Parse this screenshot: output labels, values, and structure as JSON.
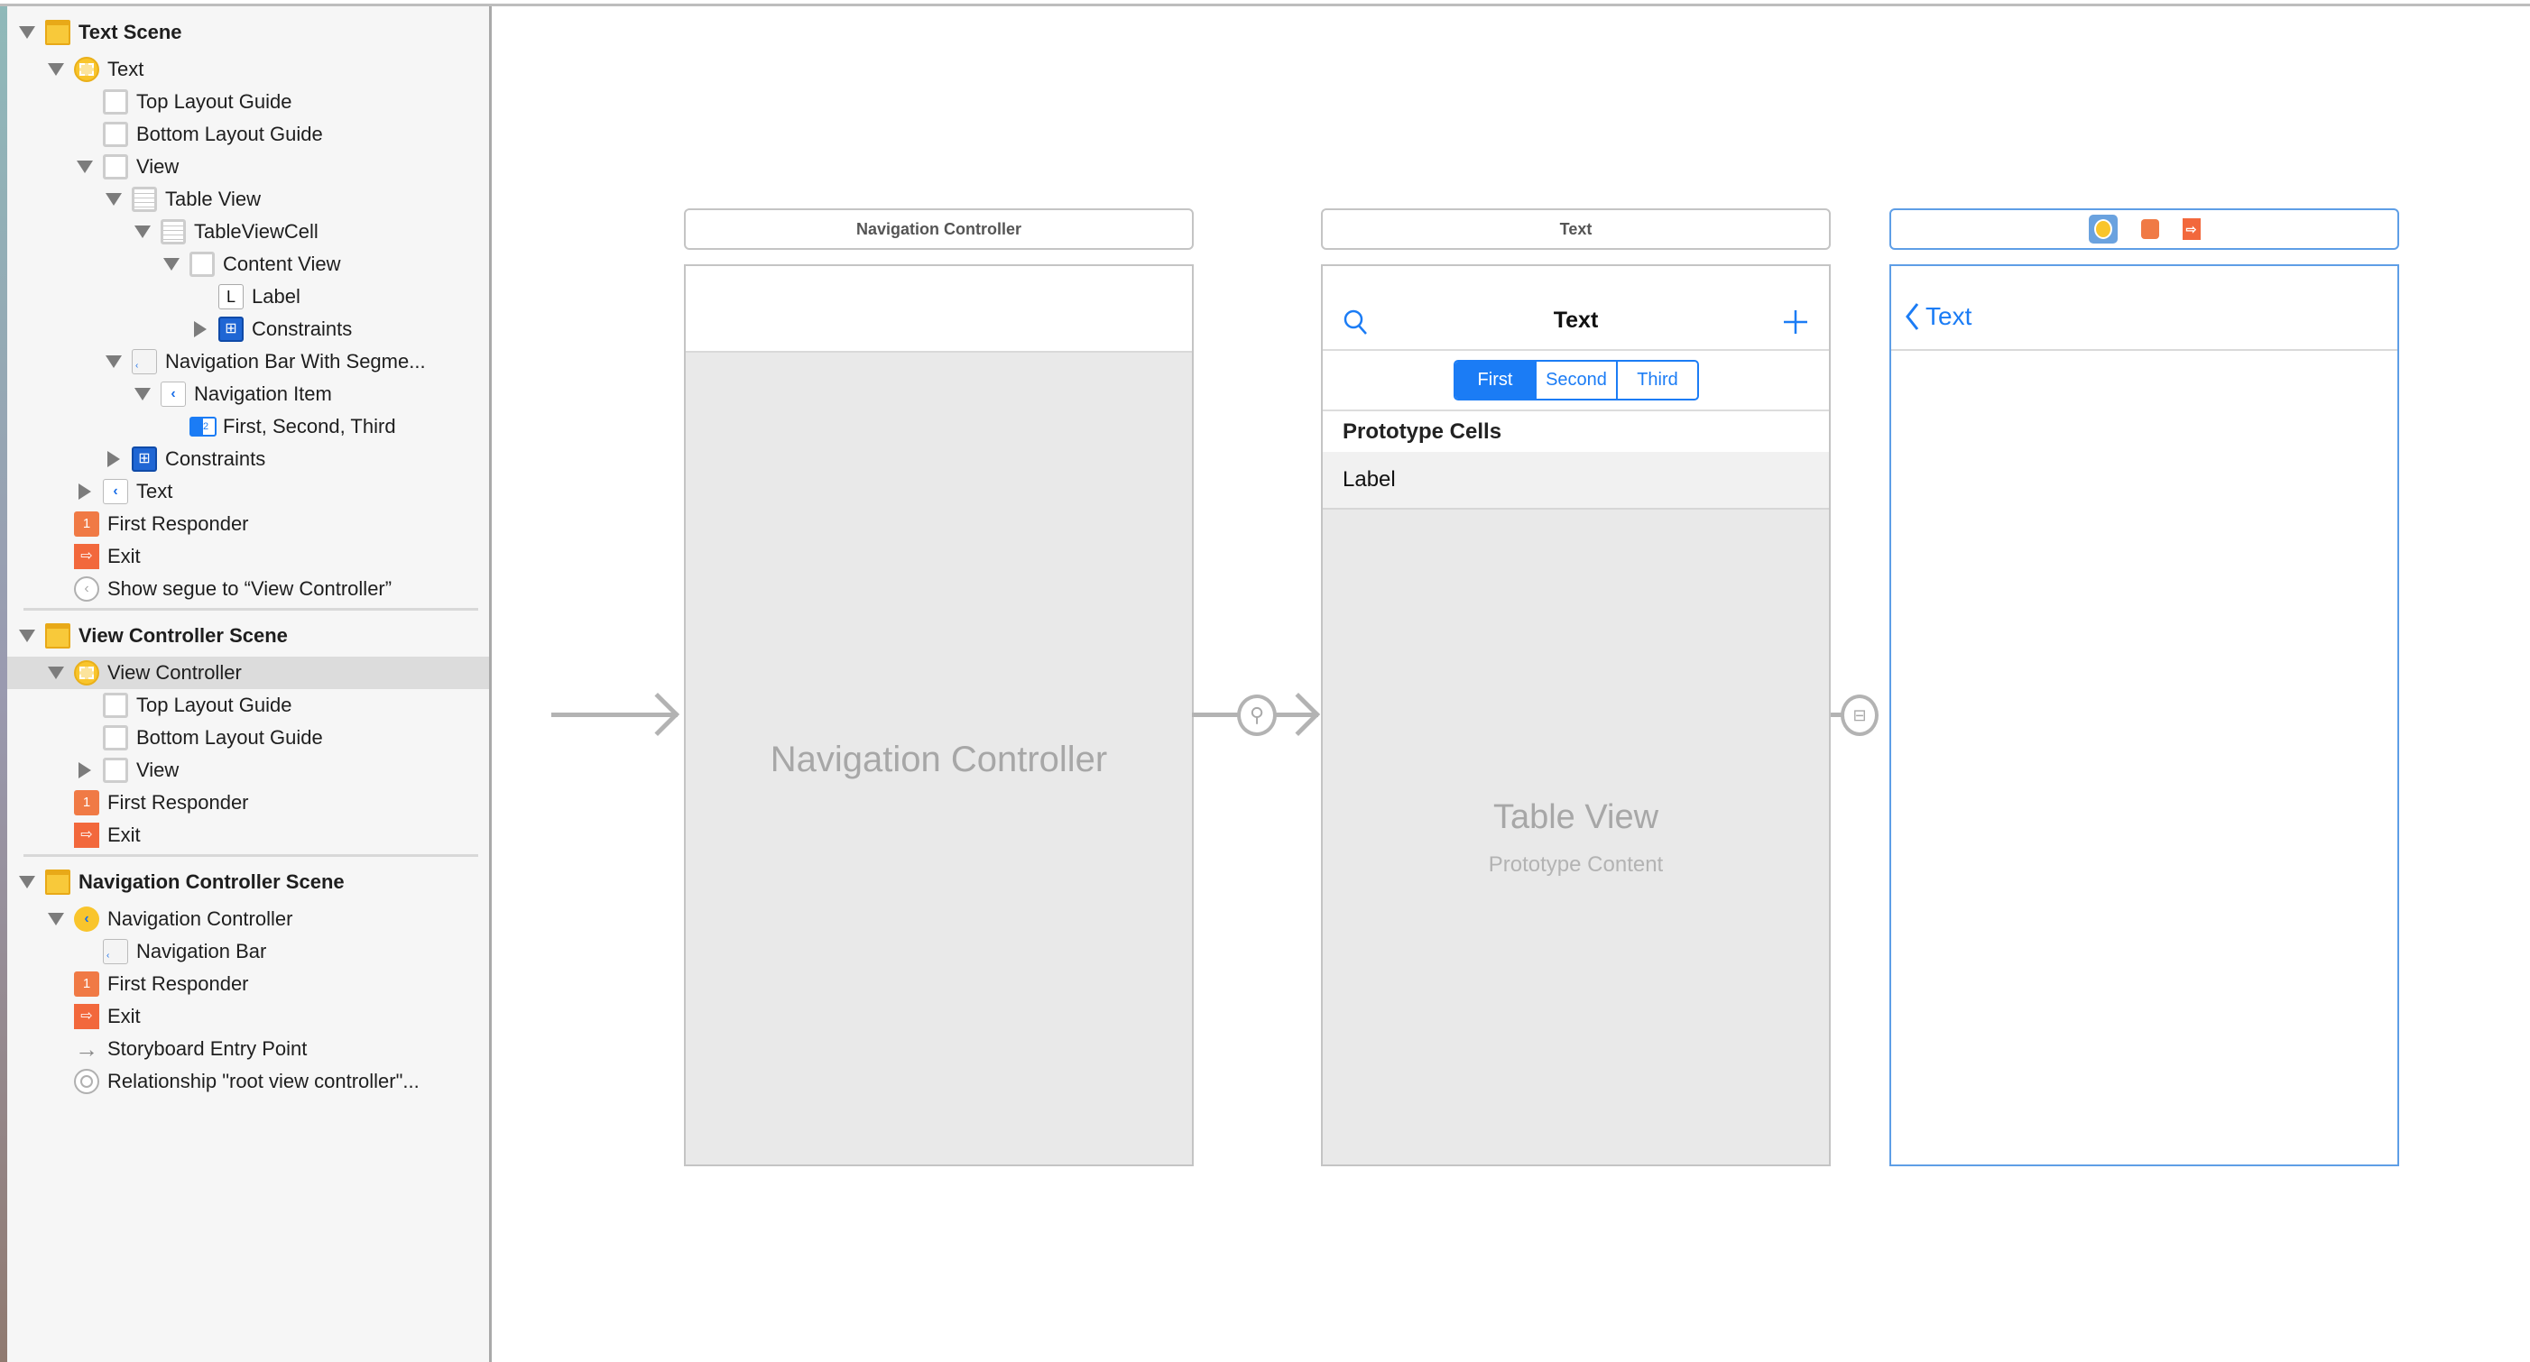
{
  "outline": [
    {
      "type": "scene",
      "label": "Text Scene",
      "level": 0,
      "disclosure": "open",
      "icon": "scene-icon"
    },
    {
      "label": "Text",
      "level": 1,
      "disclosure": "open",
      "icon": "view-controller-icon"
    },
    {
      "label": "Top Layout Guide",
      "level": 2,
      "icon": "top-layout-guide-icon"
    },
    {
      "label": "Bottom Layout Guide",
      "level": 2,
      "icon": "bottom-layout-guide-icon"
    },
    {
      "label": "View",
      "level": 2,
      "disclosure": "open",
      "icon": "view-icon"
    },
    {
      "label": "Table View",
      "level": 3,
      "disclosure": "open",
      "icon": "table-view-icon"
    },
    {
      "label": "TableViewCell",
      "level": 4,
      "disclosure": "open",
      "icon": "table-cell-icon"
    },
    {
      "label": "Content View",
      "level": 5,
      "disclosure": "open",
      "icon": "view-icon"
    },
    {
      "label": "Label",
      "level": 6,
      "icon": "label-icon"
    },
    {
      "label": "Constraints",
      "level": 6,
      "disclosure": "closed",
      "icon": "constraints-icon"
    },
    {
      "label": "Navigation Bar With Segme...",
      "level": 3,
      "disclosure": "open",
      "icon": "navigation-bar-icon"
    },
    {
      "label": "Navigation Item",
      "level": 4,
      "disclosure": "open",
      "icon": "navigation-item-icon"
    },
    {
      "label": "First, Second, Third",
      "level": 5,
      "icon": "segmented-control-icon"
    },
    {
      "label": "Constraints",
      "level": 3,
      "disclosure": "closed",
      "icon": "constraints-icon"
    },
    {
      "label": "Text",
      "level": 2,
      "disclosure": "closed",
      "icon": "navigation-item-icon"
    },
    {
      "label": "First Responder",
      "level": 1,
      "icon": "first-responder-icon"
    },
    {
      "label": "Exit",
      "level": 1,
      "icon": "exit-icon"
    },
    {
      "label": "Show segue to “View Controller”",
      "level": 1,
      "icon": "segue-icon"
    },
    {
      "type": "separator"
    },
    {
      "type": "scene",
      "label": "View Controller Scene",
      "level": 0,
      "disclosure": "open",
      "icon": "scene-icon"
    },
    {
      "label": "View Controller",
      "level": 1,
      "disclosure": "open",
      "icon": "view-controller-icon",
      "selected": true
    },
    {
      "label": "Top Layout Guide",
      "level": 2,
      "icon": "top-layout-guide-icon"
    },
    {
      "label": "Bottom Layout Guide",
      "level": 2,
      "icon": "bottom-layout-guide-icon"
    },
    {
      "label": "View",
      "level": 2,
      "disclosure": "closed",
      "icon": "view-icon"
    },
    {
      "label": "First Responder",
      "level": 1,
      "icon": "first-responder-icon"
    },
    {
      "label": "Exit",
      "level": 1,
      "icon": "exit-icon"
    },
    {
      "type": "separator"
    },
    {
      "type": "scene",
      "label": "Navigation Controller Scene",
      "level": 0,
      "disclosure": "open",
      "icon": "scene-icon"
    },
    {
      "label": "Navigation Controller",
      "level": 1,
      "disclosure": "open",
      "icon": "navigation-controller-icon"
    },
    {
      "label": "Navigation Bar",
      "level": 2,
      "icon": "navigation-bar-icon"
    },
    {
      "label": "First Responder",
      "level": 1,
      "icon": "first-responder-icon"
    },
    {
      "label": "Exit",
      "level": 1,
      "icon": "exit-icon"
    },
    {
      "label": "Storyboard Entry Point",
      "level": 1,
      "icon": "entry-point-icon"
    },
    {
      "label": "Relationship \"root view controller\"...",
      "level": 1,
      "icon": "relationship-icon"
    }
  ],
  "canvas": {
    "nav_controller": {
      "title": "Navigation Controller",
      "placeholder": "Navigation Controller"
    },
    "table_vc": {
      "title": "Text",
      "nav_title": "Text",
      "segments": [
        "First",
        "Second",
        "Third"
      ],
      "selected_segment": "First",
      "section_header": "Prototype Cells",
      "cell_label": "Label",
      "placeholder_title": "Table View",
      "placeholder_subtitle": "Prototype Content"
    },
    "view_controller": {
      "back_label": "Text"
    }
  },
  "colors": {
    "accent": "#1b7cf5",
    "selection": "#5e9ee6",
    "exit": "#f2683c",
    "scene": "#f8c93a"
  }
}
